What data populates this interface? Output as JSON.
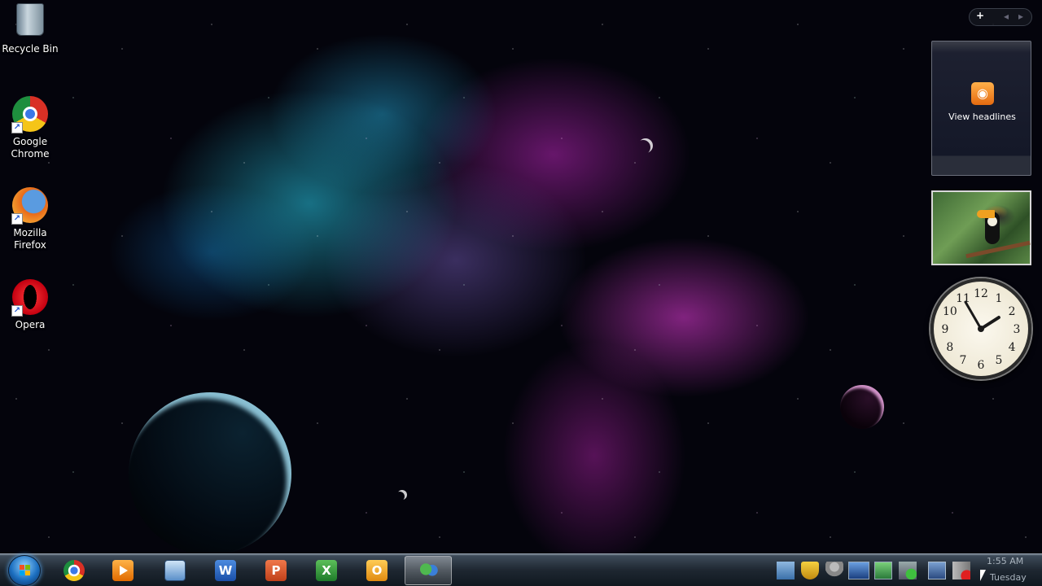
{
  "desktop": {
    "icons": [
      {
        "label_line1": "Recycle Bin",
        "label_line2": "",
        "icon": "recycle-bin-icon"
      },
      {
        "label_line1": "Google",
        "label_line2": "Chrome",
        "icon": "chrome-icon"
      },
      {
        "label_line1": "Mozilla",
        "label_line2": "Firefox",
        "icon": "firefox-icon"
      },
      {
        "label_line1": "Opera",
        "label_line2": "",
        "icon": "opera-icon"
      }
    ]
  },
  "gadgets": {
    "toolbar": {
      "add": "+",
      "prev": "◂",
      "next": "▸"
    },
    "feed": {
      "label": "View headlines",
      "icon": "rss-icon",
      "accent": "#f08a24"
    },
    "clock": {
      "hour": 1,
      "minute": 55,
      "numerals": [
        "12",
        "1",
        "2",
        "3",
        "4",
        "5",
        "6",
        "7",
        "8",
        "9",
        "10",
        "11"
      ]
    }
  },
  "taskbar": {
    "start": {
      "icon": "windows-start-orb"
    },
    "pinned": [
      {
        "name": "chrome",
        "icon": "chrome-icon"
      },
      {
        "name": "media-player",
        "icon": "media-player-icon"
      },
      {
        "name": "computer",
        "icon": "computer-icon"
      },
      {
        "name": "word",
        "icon": "word-icon",
        "letter": "W"
      },
      {
        "name": "powerpoint",
        "icon": "powerpoint-icon",
        "letter": "P"
      },
      {
        "name": "excel",
        "icon": "excel-icon",
        "letter": "X"
      },
      {
        "name": "outlook",
        "icon": "outlook-icon",
        "letter": "O"
      },
      {
        "name": "messenger",
        "icon": "messenger-icon"
      }
    ],
    "tray": {
      "icons": [
        "tray-app-icon",
        "shield-icon",
        "network-user-icon",
        "display-icon",
        "monitor-icon",
        "usb-icon",
        "network-icon",
        "volume-muted-icon"
      ],
      "time": "1:55 AM",
      "day": "Tuesday"
    }
  }
}
